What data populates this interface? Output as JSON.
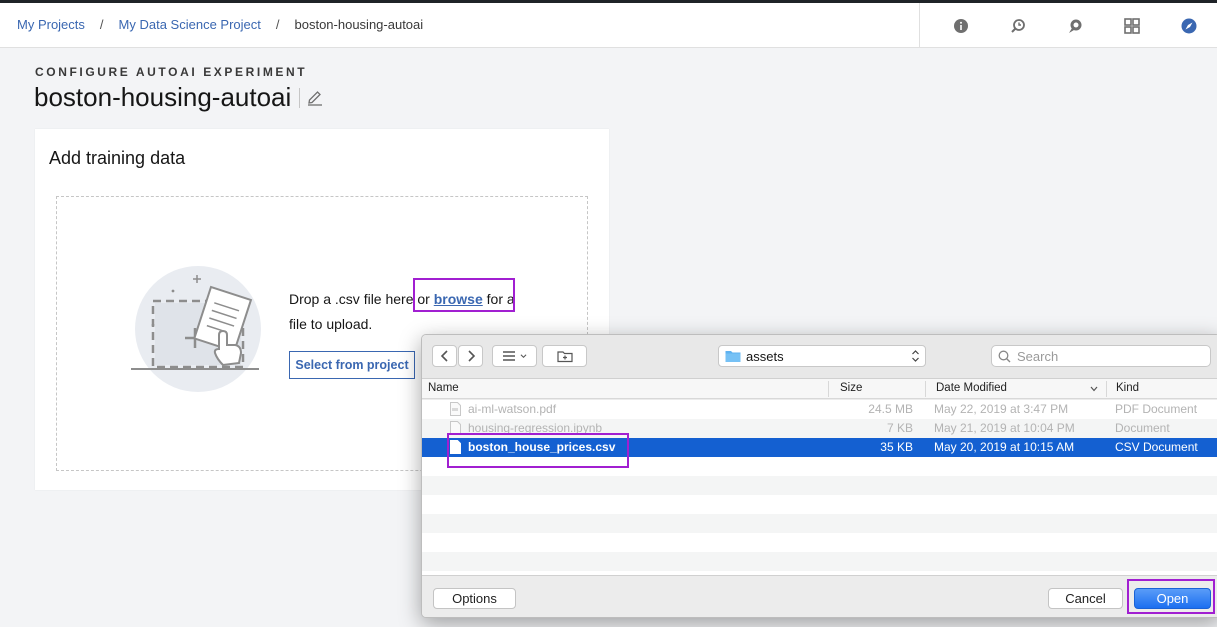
{
  "breadcrumb": {
    "items": [
      "My Projects",
      "My Data Science Project"
    ],
    "current": "boston-housing-autoai",
    "separator": "/"
  },
  "top_icons": [
    "info-icon",
    "history-icon",
    "chat-icon",
    "apps-grid-icon",
    "compass-icon"
  ],
  "header": {
    "eyebrow": "CONFIGURE AUTOAI EXPERIMENT",
    "title": "boston-housing-autoai"
  },
  "card": {
    "title": "Add training data",
    "drop_text_before": "Drop a .csv file here or ",
    "browse_label": "browse",
    "drop_text_after": " for a file to upload.",
    "select_button": "Select from project"
  },
  "dialog": {
    "location": "assets",
    "search_placeholder": "Search",
    "columns": {
      "name": "Name",
      "size": "Size",
      "date": "Date Modified",
      "kind": "Kind"
    },
    "files": [
      {
        "name": "ai-ml-watson.pdf",
        "size": "24.5 MB",
        "date": "May 22, 2019 at 3:47 PM",
        "kind": "PDF Document",
        "state": "dim"
      },
      {
        "name": "housing-regression.ipynb",
        "size": "7 KB",
        "date": "May 21, 2019 at 10:04 PM",
        "kind": "Document",
        "state": "dim"
      },
      {
        "name": "boston_house_prices.csv",
        "size": "35 KB",
        "date": "May 20, 2019 at 10:15 AM",
        "kind": "CSV Document",
        "state": "selected"
      }
    ],
    "options_button": "Options",
    "cancel_button": "Cancel",
    "open_button": "Open"
  },
  "colors": {
    "link": "#3a67b1",
    "highlight": "#a11fd1",
    "selection": "#1460d1"
  }
}
